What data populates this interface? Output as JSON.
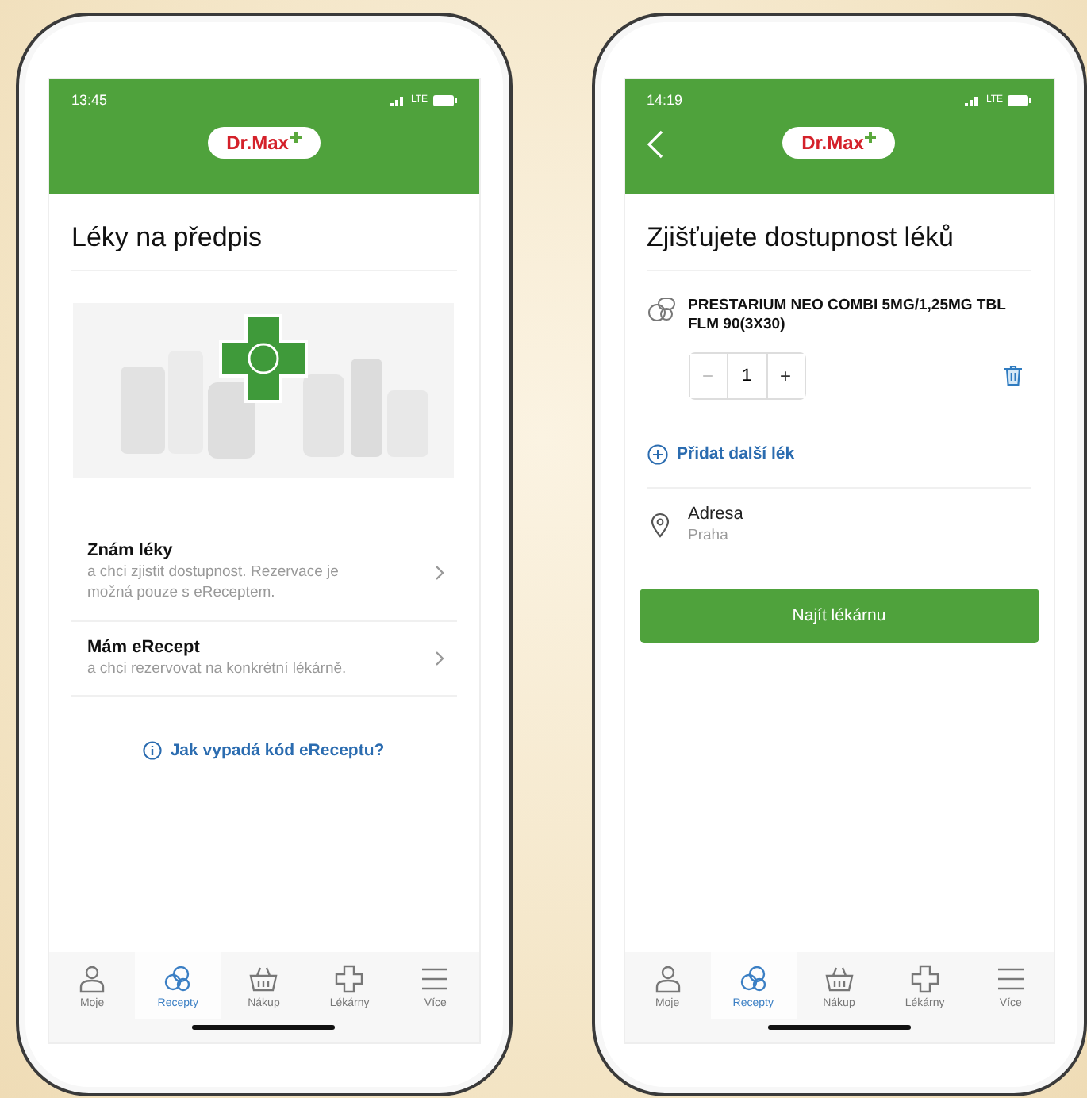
{
  "phones": [
    {
      "kind": "prescriptions",
      "status_bar": {
        "time": "13:45",
        "network": "LTE"
      },
      "header": {
        "logo": "Dr.Max",
        "back_button": false
      },
      "title": "Léky na předpis",
      "options": [
        {
          "title": "Znám léky",
          "description": "a chci zjistit dostupnost. Rezervace je možná pouze s eReceptem."
        },
        {
          "title": "Mám eRecept",
          "description": "a chci rezervovat na konkrétní lékárně."
        }
      ],
      "help_link": "Jak vypadá kód eReceptu?",
      "tab_bar": [
        {
          "label": "Moje",
          "selected": false
        },
        {
          "label": "Recepty",
          "selected": true
        },
        {
          "label": "Nákup",
          "selected": false
        },
        {
          "label": "Lékárny",
          "selected": false
        },
        {
          "label": "Více",
          "selected": false
        }
      ]
    },
    {
      "kind": "availability",
      "status_bar": {
        "time": "14:19",
        "network": "LTE"
      },
      "header": {
        "logo": "Dr.Max",
        "back_button": true
      },
      "title": "Zjišťujete dostupnost léků",
      "medicine": {
        "name": "PRESTARIUM NEO COMBI 5MG/1,25MG TBL FLM 90(3X30)",
        "minus": "−",
        "quantity": "1",
        "plus": "+"
      },
      "add_link": "Přidat další lék",
      "address": {
        "label": "Adresa",
        "value": "Praha"
      },
      "button": "Najít lékárnu",
      "tab_bar": [
        {
          "label": "Moje",
          "selected": false
        },
        {
          "label": "Recepty",
          "selected": true
        },
        {
          "label": "Nákup",
          "selected": false
        },
        {
          "label": "Lékárny",
          "selected": false
        },
        {
          "label": "Více",
          "selected": false
        }
      ]
    }
  ]
}
